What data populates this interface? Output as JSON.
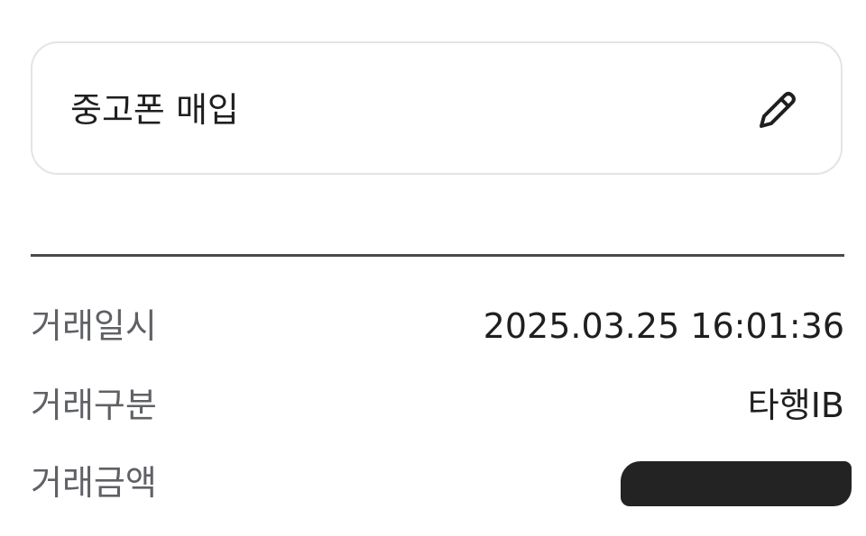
{
  "memo": {
    "text": "중고폰 매입",
    "edit_icon": "pencil-icon"
  },
  "details": [
    {
      "label": "거래일시",
      "value": "2025.03.25 16:01:36"
    },
    {
      "label": "거래구분",
      "value": "타행IB"
    },
    {
      "label": "거래금액",
      "value": ""
    }
  ],
  "colors": {
    "label_text": "#5f6166",
    "value_text": "#1f1f1f",
    "card_border": "#e3e4e8",
    "divider": "#4a4a4c",
    "redaction": "#232323"
  }
}
